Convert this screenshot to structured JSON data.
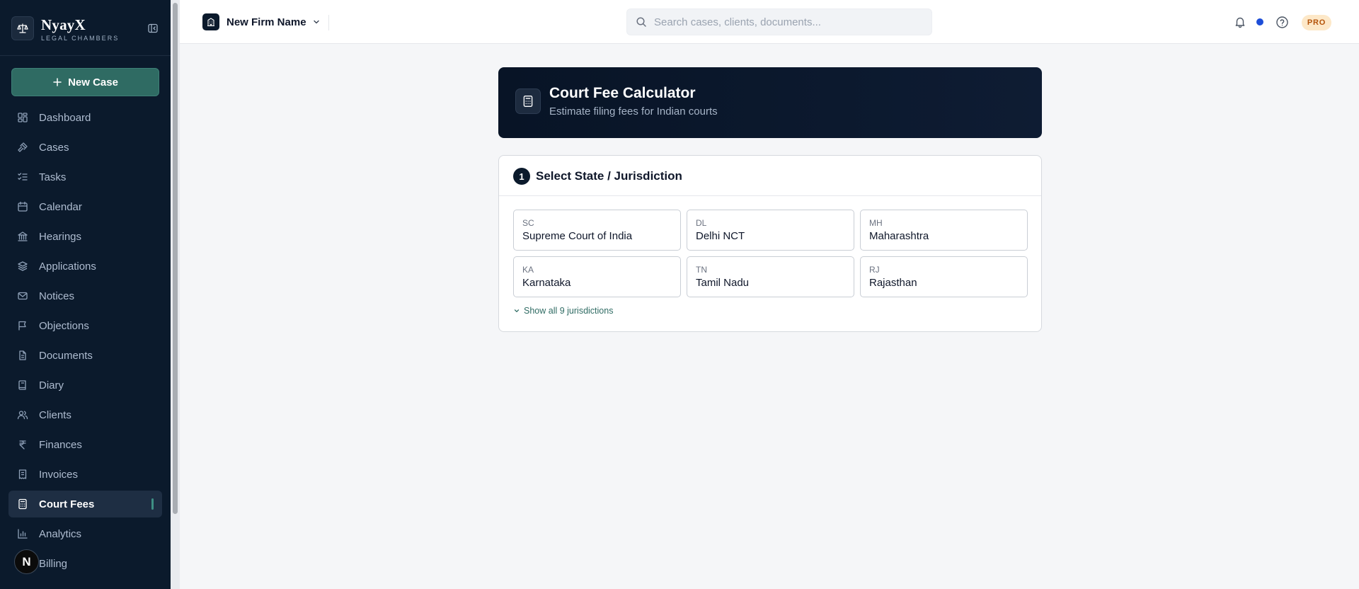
{
  "brand": {
    "name": "NyayX",
    "tagline": "LEGAL CHAMBERS"
  },
  "sidebar": {
    "new_case_label": "New Case",
    "items": [
      {
        "label": "Dashboard",
        "icon": "dashboard-icon"
      },
      {
        "label": "Cases",
        "icon": "gavel-icon"
      },
      {
        "label": "Tasks",
        "icon": "list-check-icon"
      },
      {
        "label": "Calendar",
        "icon": "calendar-icon"
      },
      {
        "label": "Hearings",
        "icon": "courthouse-icon"
      },
      {
        "label": "Applications",
        "icon": "layers-icon"
      },
      {
        "label": "Notices",
        "icon": "mail-icon"
      },
      {
        "label": "Objections",
        "icon": "flag-icon"
      },
      {
        "label": "Documents",
        "icon": "document-icon"
      },
      {
        "label": "Diary",
        "icon": "book-icon"
      },
      {
        "label": "Clients",
        "icon": "users-icon"
      },
      {
        "label": "Finances",
        "icon": "rupee-icon"
      },
      {
        "label": "Invoices",
        "icon": "receipt-icon"
      },
      {
        "label": "Court Fees",
        "icon": "calculator-icon",
        "active": true
      },
      {
        "label": "Analytics",
        "icon": "bar-chart-icon"
      },
      {
        "label": "Billing",
        "icon": "credit-card-icon"
      }
    ],
    "avatar_initial": "N"
  },
  "topbar": {
    "firm_name": "New Firm Name",
    "search_placeholder": "Search cases, clients, documents...",
    "plan_badge": "PRO"
  },
  "hero": {
    "title": "Court Fee Calculator",
    "subtitle": "Estimate filing fees for Indian courts"
  },
  "jurisdiction": {
    "step": "1",
    "title": "Select State / Jurisdiction",
    "options": [
      {
        "code": "SC",
        "name": "Supreme Court of India"
      },
      {
        "code": "DL",
        "name": "Delhi NCT"
      },
      {
        "code": "MH",
        "name": "Maharashtra"
      },
      {
        "code": "KA",
        "name": "Karnataka"
      },
      {
        "code": "TN",
        "name": "Tamil Nadu"
      },
      {
        "code": "RJ",
        "name": "Rajasthan"
      }
    ],
    "show_all_label": "Show all 9 jurisdictions"
  },
  "colors": {
    "sidebar_bg": "#0b1a2c",
    "accent": "#2f6b63",
    "notification_dot": "#1d4ed8",
    "pro_badge_bg": "#fde8c8",
    "pro_badge_text": "#b45309"
  }
}
